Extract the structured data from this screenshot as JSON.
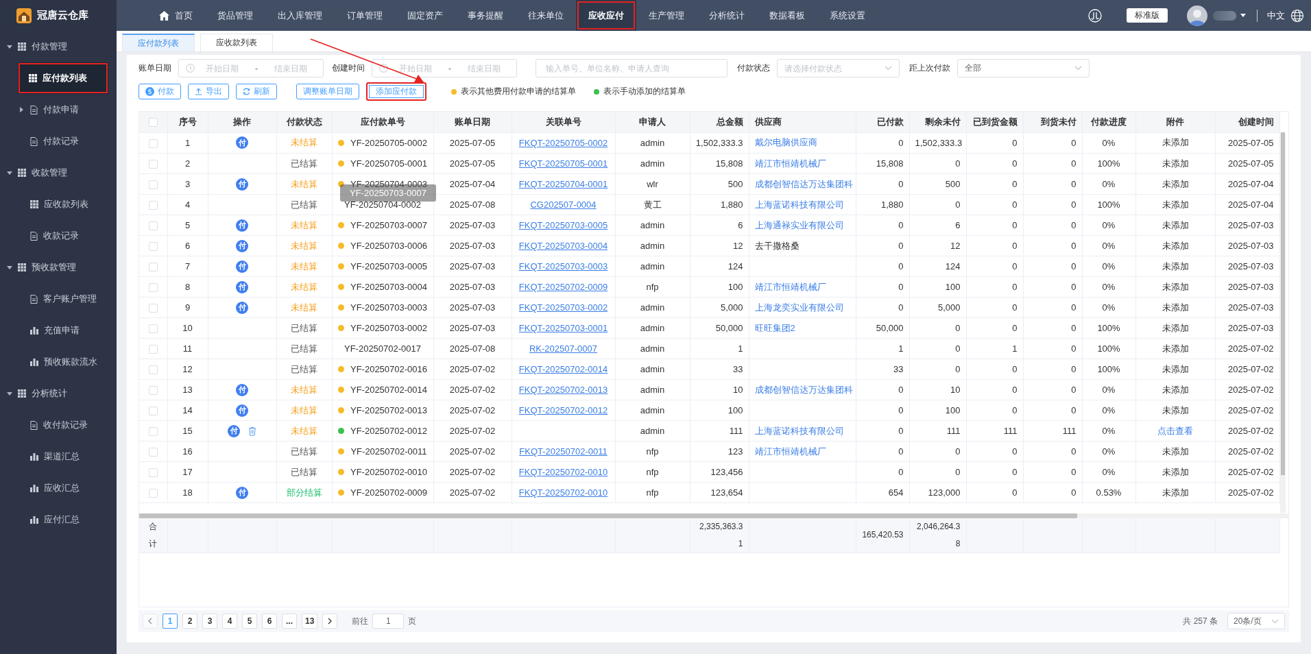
{
  "topbar": {
    "logo": "冠唐云仓库",
    "nav": [
      {
        "label": "首页",
        "kind": "home",
        "selected": false,
        "highlighted": false
      },
      {
        "label": "货品管理",
        "kind": "text",
        "selected": false,
        "highlighted": false
      },
      {
        "label": "出入库管理",
        "kind": "text",
        "selected": false,
        "highlighted": false
      },
      {
        "label": "订单管理",
        "kind": "text",
        "selected": false,
        "highlighted": false
      },
      {
        "label": "固定资产",
        "kind": "text",
        "selected": false,
        "highlighted": false
      },
      {
        "label": "事务提醒",
        "kind": "text",
        "selected": false,
        "highlighted": false
      },
      {
        "label": "往来单位",
        "kind": "text",
        "selected": false,
        "highlighted": false
      },
      {
        "label": "应收应付",
        "kind": "text",
        "selected": true,
        "highlighted": true
      },
      {
        "label": "生产管理",
        "kind": "text",
        "selected": false,
        "highlighted": false
      },
      {
        "label": "分析统计",
        "kind": "text",
        "selected": false,
        "highlighted": false
      },
      {
        "label": "数据看板",
        "kind": "text",
        "selected": false,
        "highlighted": false
      },
      {
        "label": "系统设置",
        "kind": "text",
        "selected": false,
        "highlighted": false
      }
    ],
    "edition": "标准版",
    "language": "中文"
  },
  "sidebar": {
    "groups": [
      {
        "label": "付款管理",
        "expanded": true,
        "items": [
          {
            "label": "应付款列表",
            "kind": "list",
            "selected": true,
            "highlighted": true
          },
          {
            "label": "付款申请",
            "kind": "page",
            "selected": false,
            "highlighted": false,
            "expanded": false
          },
          {
            "label": "付款记录",
            "kind": "page",
            "selected": false,
            "highlighted": false
          }
        ]
      },
      {
        "label": "收款管理",
        "expanded": true,
        "items": [
          {
            "label": "应收款列表",
            "kind": "list",
            "selected": false,
            "highlighted": false
          },
          {
            "label": "收款记录",
            "kind": "page",
            "selected": false,
            "highlighted": false
          }
        ]
      },
      {
        "label": "预收款管理",
        "expanded": true,
        "items": [
          {
            "label": "客户账户管理",
            "kind": "page",
            "selected": false,
            "highlighted": false
          },
          {
            "label": "充值申请",
            "kind": "report",
            "selected": false,
            "highlighted": false
          },
          {
            "label": "预收账款流水",
            "kind": "report",
            "selected": false,
            "highlighted": false
          }
        ]
      },
      {
        "label": "分析统计",
        "expanded": true,
        "items": [
          {
            "label": "收付款记录",
            "kind": "page",
            "selected": false,
            "highlighted": false
          },
          {
            "label": "渠道汇总",
            "kind": "report",
            "selected": false,
            "highlighted": false
          },
          {
            "label": "应收汇总",
            "kind": "report",
            "selected": false,
            "highlighted": false
          },
          {
            "label": "应付汇总",
            "kind": "report",
            "selected": false,
            "highlighted": false
          }
        ]
      }
    ]
  },
  "tabs": [
    {
      "label": "应付款列表",
      "selected": true
    },
    {
      "label": "应收款列表",
      "selected": false
    }
  ],
  "filters": {
    "bill_date": {
      "label": "账单日期",
      "start_placeholder": "开始日期",
      "separator": "-",
      "end_placeholder": "结束日期"
    },
    "created": {
      "label": "创建时间",
      "start_placeholder": "开始日期",
      "separator": "-",
      "end_placeholder": "结束日期"
    },
    "search": {
      "placeholder": "输入单号、单位名称、申请人查询"
    },
    "status": {
      "label": "付款状态",
      "placeholder": "请选择付款状态"
    },
    "last_payment": {
      "label": "距上次付款",
      "value": "全部"
    }
  },
  "actions": [
    {
      "label": "付款",
      "kind": "pay",
      "highlighted": false
    },
    {
      "label": "导出",
      "kind": "export",
      "highlighted": false
    },
    {
      "label": "刷新",
      "kind": "refresh",
      "highlighted": false
    },
    {
      "label": "调整账单日期",
      "kind": "text",
      "highlighted": false
    },
    {
      "label": "添加应付款",
      "kind": "text",
      "highlighted": true
    }
  ],
  "legend": [
    {
      "color": "#f7ba2a",
      "text": "表示其他费用付款申请的结算单"
    },
    {
      "color": "#3cc150",
      "text": "表示手动添加的结算单"
    }
  ],
  "table": {
    "select_all_checked": false,
    "columns": [
      "序号",
      "操作",
      "付款状态",
      "应付款单号",
      "账单日期",
      "关联单号",
      "申请人",
      "总金额",
      "供应商",
      "已付款",
      "剩余未付",
      "已到货金额",
      "到货未付",
      "付款进度",
      "附件",
      "创建时间"
    ],
    "tooltip": "YF-20250703-0007",
    "rows": [
      {
        "checked": false,
        "no": "1",
        "actions": [
          {
            "kind": "pay",
            "label": "付"
          }
        ],
        "status": "未结算",
        "kind": "unsettled",
        "color": "#f7ba2a",
        "order": "YF-20250705-0002",
        "bill_date": "2025-07-05",
        "related": "FKQT-20250705-0002",
        "applicant": "admin",
        "total": "1,502,333.3",
        "supplier": "戴尔电脑供应商",
        "supplier_link": true,
        "paid": "0",
        "remaining": "1,502,333.3",
        "arrived": "0",
        "arrived_unpaid": "0",
        "progress": "0%",
        "attachment": "未添加",
        "attachment_link": false,
        "created": "2025-07-05"
      },
      {
        "checked": false,
        "no": "2",
        "actions": [],
        "status": "已结算",
        "kind": "settled",
        "color": "#f7ba2a",
        "order": "YF-20250705-0001",
        "bill_date": "2025-07-05",
        "related": "FKQT-20250705-0001",
        "applicant": "admin",
        "total": "15,808",
        "supplier": "靖江市恒靖机械厂",
        "supplier_link": true,
        "paid": "15,808",
        "remaining": "0",
        "arrived": "0",
        "arrived_unpaid": "0",
        "progress": "100%",
        "attachment": "未添加",
        "attachment_link": false,
        "created": "2025-07-05"
      },
      {
        "checked": false,
        "no": "3",
        "actions": [
          {
            "kind": "pay",
            "label": "付"
          }
        ],
        "status": "未结算",
        "kind": "unsettled",
        "color": "#f7ba2a",
        "order": "YF-20250704-0003",
        "bill_date": "2025-07-04",
        "related": "FKQT-20250704-0001",
        "applicant": "wlr",
        "total": "500",
        "supplier": "成都创智信达万达集团科",
        "supplier_link": true,
        "paid": "0",
        "remaining": "500",
        "arrived": "0",
        "arrived_unpaid": "0",
        "progress": "0%",
        "attachment": "未添加",
        "attachment_link": false,
        "created": "2025-07-04"
      },
      {
        "checked": false,
        "no": "4",
        "actions": [],
        "status": "已结算",
        "kind": "settled",
        "order": "YF-20250704-0002",
        "bill_date": "2025-07-08",
        "related": "CG202507-0004",
        "applicant": "黄工",
        "total": "1,880",
        "supplier": "上海蓝诺科技有限公司",
        "supplier_link": true,
        "paid": "1,880",
        "remaining": "0",
        "arrived": "0",
        "arrived_unpaid": "0",
        "progress": "100%",
        "attachment": "未添加",
        "attachment_link": false,
        "created": "2025-07-04"
      },
      {
        "checked": false,
        "no": "5",
        "actions": [
          {
            "kind": "pay",
            "label": "付"
          }
        ],
        "status": "未结算",
        "kind": "unsettled",
        "color": "#f7ba2a",
        "order": "YF-20250703-0007",
        "bill_date": "2025-07-03",
        "related": "FKQT-20250703-0005",
        "applicant": "admin",
        "total": "6",
        "supplier": "上海通禄实业有限公司",
        "supplier_link": true,
        "paid": "0",
        "remaining": "6",
        "arrived": "0",
        "arrived_unpaid": "0",
        "progress": "0%",
        "attachment": "未添加",
        "attachment_link": false,
        "created": "2025-07-03"
      },
      {
        "checked": false,
        "no": "6",
        "actions": [
          {
            "kind": "pay",
            "label": "付"
          }
        ],
        "status": "未结算",
        "kind": "unsettled",
        "color": "#f7ba2a",
        "order": "YF-20250703-0006",
        "bill_date": "2025-07-03",
        "related": "FKQT-20250703-0004",
        "applicant": "admin",
        "total": "12",
        "supplier": "去干撒格桑",
        "supplier_link": false,
        "paid": "0",
        "remaining": "12",
        "arrived": "0",
        "arrived_unpaid": "0",
        "progress": "0%",
        "attachment": "未添加",
        "attachment_link": false,
        "created": "2025-07-03"
      },
      {
        "checked": false,
        "no": "7",
        "actions": [
          {
            "kind": "pay",
            "label": "付"
          }
        ],
        "status": "未结算",
        "kind": "unsettled",
        "color": "#f7ba2a",
        "order": "YF-20250703-0005",
        "bill_date": "2025-07-03",
        "related": "FKQT-20250703-0003",
        "applicant": "admin",
        "total": "124",
        "paid": "0",
        "remaining": "124",
        "arrived": "0",
        "arrived_unpaid": "0",
        "progress": "0%",
        "attachment": "未添加",
        "attachment_link": false,
        "created": "2025-07-03"
      },
      {
        "checked": false,
        "no": "8",
        "actions": [
          {
            "kind": "pay",
            "label": "付"
          }
        ],
        "status": "未结算",
        "kind": "unsettled",
        "color": "#f7ba2a",
        "order": "YF-20250703-0004",
        "bill_date": "2025-07-03",
        "related": "FKQT-20250702-0009",
        "applicant": "nfp",
        "total": "100",
        "supplier": "靖江市恒靖机械厂",
        "supplier_link": true,
        "paid": "0",
        "remaining": "100",
        "arrived": "0",
        "arrived_unpaid": "0",
        "progress": "0%",
        "attachment": "未添加",
        "attachment_link": false,
        "created": "2025-07-03"
      },
      {
        "checked": false,
        "no": "9",
        "actions": [
          {
            "kind": "pay",
            "label": "付"
          }
        ],
        "status": "未结算",
        "kind": "unsettled",
        "color": "#f7ba2a",
        "order": "YF-20250703-0003",
        "bill_date": "2025-07-03",
        "related": "FKQT-20250703-0002",
        "applicant": "admin",
        "total": "5,000",
        "supplier": "上海龙奕实业有限公司",
        "supplier_link": true,
        "paid": "0",
        "remaining": "5,000",
        "arrived": "0",
        "arrived_unpaid": "0",
        "progress": "0%",
        "attachment": "未添加",
        "attachment_link": false,
        "created": "2025-07-03"
      },
      {
        "checked": false,
        "no": "10",
        "actions": [],
        "status": "已结算",
        "kind": "settled",
        "color": "#f7ba2a",
        "order": "YF-20250703-0002",
        "bill_date": "2025-07-03",
        "related": "FKQT-20250703-0001",
        "applicant": "admin",
        "total": "50,000",
        "supplier": "旺旺集团2",
        "supplier_link": true,
        "paid": "50,000",
        "remaining": "0",
        "arrived": "0",
        "arrived_unpaid": "0",
        "progress": "100%",
        "attachment": "未添加",
        "attachment_link": false,
        "created": "2025-07-03"
      },
      {
        "checked": false,
        "no": "11",
        "actions": [],
        "status": "已结算",
        "kind": "settled",
        "order": "YF-20250702-0017",
        "bill_date": "2025-07-08",
        "related": "RK-202507-0007",
        "applicant": "admin",
        "total": "1",
        "paid": "1",
        "remaining": "0",
        "arrived": "1",
        "arrived_unpaid": "0",
        "progress": "100%",
        "attachment": "未添加",
        "attachment_link": false,
        "created": "2025-07-02"
      },
      {
        "checked": false,
        "no": "12",
        "actions": [],
        "status": "已结算",
        "kind": "settled",
        "color": "#f7ba2a",
        "order": "YF-20250702-0016",
        "bill_date": "2025-07-02",
        "related": "FKQT-20250702-0014",
        "applicant": "admin",
        "total": "33",
        "paid": "33",
        "remaining": "0",
        "arrived": "0",
        "arrived_unpaid": "0",
        "progress": "100%",
        "attachment": "未添加",
        "attachment_link": false,
        "created": "2025-07-02"
      },
      {
        "checked": false,
        "no": "13",
        "actions": [
          {
            "kind": "pay",
            "label": "付"
          }
        ],
        "status": "未结算",
        "kind": "unsettled",
        "color": "#f7ba2a",
        "order": "YF-20250702-0014",
        "bill_date": "2025-07-02",
        "related": "FKQT-20250702-0013",
        "applicant": "admin",
        "total": "10",
        "supplier": "成都创智信达万达集团科",
        "supplier_link": true,
        "paid": "0",
        "remaining": "10",
        "arrived": "0",
        "arrived_unpaid": "0",
        "progress": "0%",
        "attachment": "未添加",
        "attachment_link": false,
        "created": "2025-07-02"
      },
      {
        "checked": false,
        "no": "14",
        "actions": [
          {
            "kind": "pay",
            "label": "付"
          }
        ],
        "status": "未结算",
        "kind": "unsettled",
        "color": "#f7ba2a",
        "order": "YF-20250702-0013",
        "bill_date": "2025-07-02",
        "related": "FKQT-20250702-0012",
        "applicant": "admin",
        "total": "100",
        "paid": "0",
        "remaining": "100",
        "arrived": "0",
        "arrived_unpaid": "0",
        "progress": "0%",
        "attachment": "未添加",
        "attachment_link": false,
        "created": "2025-07-02"
      },
      {
        "checked": false,
        "no": "15",
        "actions": [
          {
            "kind": "pay",
            "label": "付"
          },
          {
            "kind": "delete"
          }
        ],
        "status": "未结算",
        "kind": "unsettled",
        "color": "#3cc150",
        "order": "YF-20250702-0012",
        "bill_date": "2025-07-02",
        "applicant": "admin",
        "total": "111",
        "supplier": "上海蓝诺科技有限公司",
        "supplier_link": true,
        "paid": "0",
        "remaining": "111",
        "arrived": "111",
        "arrived_unpaid": "111",
        "progress": "0%",
        "attachment": "点击查看",
        "attachment_link": true,
        "created": "2025-07-02"
      },
      {
        "checked": false,
        "no": "16",
        "actions": [],
        "status": "已结算",
        "kind": "settled",
        "color": "#f7ba2a",
        "order": "YF-20250702-0011",
        "bill_date": "2025-07-02",
        "related": "FKQT-20250702-0011",
        "applicant": "nfp",
        "total": "123",
        "supplier": "靖江市恒靖机械厂",
        "supplier_link": true,
        "paid": "0",
        "remaining": "0",
        "arrived": "0",
        "arrived_unpaid": "0",
        "progress": "0%",
        "attachment": "未添加",
        "attachment_link": false,
        "created": "2025-07-02"
      },
      {
        "checked": false,
        "no": "17",
        "actions": [],
        "status": "已结算",
        "kind": "settled",
        "color": "#f7ba2a",
        "order": "YF-20250702-0010",
        "bill_date": "2025-07-02",
        "related": "FKQT-20250702-0010",
        "applicant": "nfp",
        "total": "123,456",
        "paid": "0",
        "remaining": "0",
        "arrived": "0",
        "arrived_unpaid": "0",
        "progress": "0%",
        "attachment": "未添加",
        "attachment_link": false,
        "created": "2025-07-02"
      },
      {
        "checked": false,
        "no": "18",
        "actions": [
          {
            "kind": "pay",
            "label": "付"
          }
        ],
        "status": "部分结算",
        "kind": "partial",
        "color": "#f7ba2a",
        "order": "YF-20250702-0009",
        "bill_date": "2025-07-02",
        "related": "FKQT-20250702-0010",
        "applicant": "nfp",
        "total": "123,654",
        "paid": "654",
        "remaining": "123,000",
        "arrived": "0",
        "arrived_unpaid": "0",
        "progress": "0.53%",
        "attachment": "未添加",
        "attachment_link": false,
        "created": "2025-07-02"
      }
    ],
    "totals": {
      "label": "合计",
      "total": "2,335,363.31",
      "paid": "165,420.53",
      "remaining": "2,046,264.38"
    }
  },
  "pager": {
    "prev_disabled": true,
    "pages": [
      {
        "label": "1",
        "selected": true
      },
      {
        "label": "2",
        "selected": false
      },
      {
        "label": "3",
        "selected": false
      },
      {
        "label": "4",
        "selected": false
      },
      {
        "label": "5",
        "selected": false
      },
      {
        "label": "6",
        "selected": false
      },
      {
        "label": "...",
        "selected": false
      },
      {
        "label": "13",
        "selected": false
      }
    ],
    "goto_label": "前往",
    "goto_value": "1",
    "goto_suffix": "页",
    "total": "共 257 条",
    "page_size": "20条/页"
  }
}
